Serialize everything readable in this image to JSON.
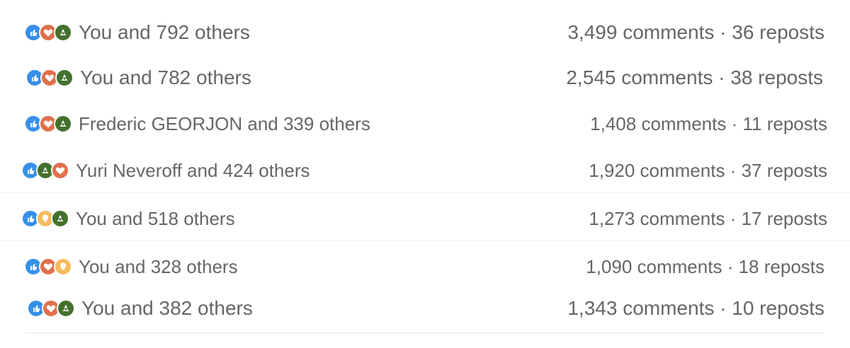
{
  "rows": [
    {
      "reactions": [
        "like-icon",
        "love-icon",
        "celebrate-icon"
      ],
      "names": "You and 792 others",
      "comments": "3,499 comments",
      "sep": "·",
      "reposts": "36 reposts"
    },
    {
      "reactions": [
        "like-icon",
        "love-icon",
        "celebrate-icon"
      ],
      "names": "You and 782 others",
      "comments": "2,545 comments",
      "sep": "·",
      "reposts": "38 reposts"
    },
    {
      "reactions": [
        "like-icon",
        "love-icon",
        "celebrate-icon"
      ],
      "names": "Frederic GEORJON and 339 others",
      "comments": "1,408 comments",
      "sep": "·",
      "reposts": "11 reposts"
    },
    {
      "reactions": [
        "like-icon",
        "celebrate-icon",
        "love-icon"
      ],
      "names": "Yuri Neveroff and 424 others",
      "comments": "1,920 comments",
      "sep": "·",
      "reposts": "37 reposts"
    },
    {
      "reactions": [
        "like-icon",
        "insight-icon",
        "celebrate-icon"
      ],
      "names": "You and 518 others",
      "comments": "1,273 comments",
      "sep": "·",
      "reposts": "17 reposts"
    },
    {
      "reactions": [
        "like-icon",
        "love-icon",
        "insight-icon"
      ],
      "names": "You and 328 others",
      "comments": "1,090 comments",
      "sep": "·",
      "reposts": "18 reposts"
    },
    {
      "reactions": [
        "like-icon",
        "love-icon",
        "celebrate-icon"
      ],
      "names": "You and 382 others",
      "comments": "1,343 comments",
      "sep": "·",
      "reposts": "10 reposts"
    }
  ],
  "colors": {
    "like": "#378fe9",
    "love": "#df704d",
    "celebrate": "#44712e",
    "insight": "#f5bb5c",
    "text": "#666666"
  }
}
